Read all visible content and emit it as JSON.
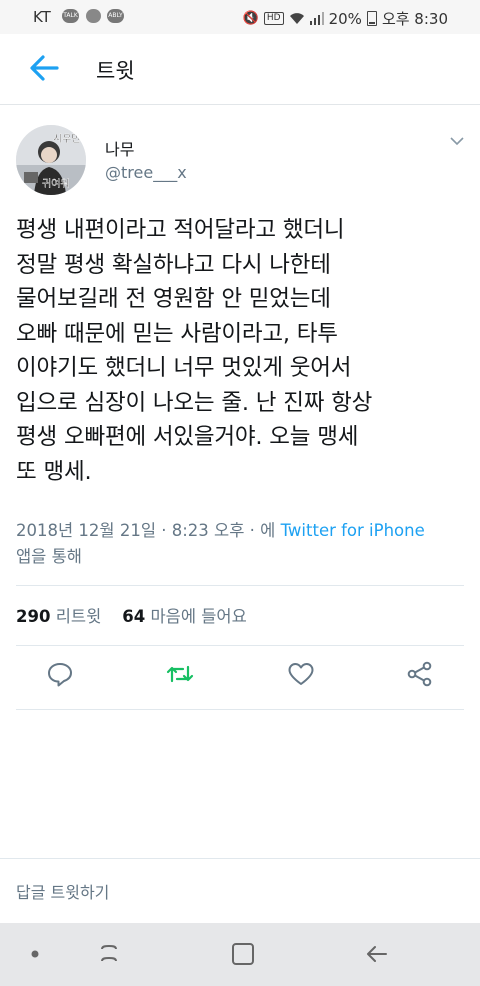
{
  "status_bar": {
    "carrier": "KT",
    "app_icons": [
      "TALK",
      "",
      "ABLY"
    ],
    "hd": "HD",
    "battery": "20%",
    "time": "오후 8:30"
  },
  "header": {
    "title": "트윗"
  },
  "tweet": {
    "avatar_text_top": "시우민",
    "avatar_text_bottom": "귀여워",
    "author_name": "나무",
    "author_handle": "@tree___x",
    "body_lines": [
      "평생 내편이라고 적어달라고 했더니",
      "정말 평생 확실하냐고 다시 나한테",
      "물어보길래 전 영원함 안 믿었는데",
      "오빠 때문에 믿는 사람이라고, 타투",
      "이야기도 했더니 너무 멋있게 웃어서",
      "입으로 심장이 나오는 줄. 난 진짜 항상",
      "평생 오빠편에 서있을거야. 오늘 맹세",
      "또 맹세."
    ],
    "timestamp": "2018년 12월 21일 · 8:23 오후 · 에",
    "source": "Twitter for iPhone",
    "source_suffix": "앱을 통해",
    "retweet_count": "290",
    "retweet_label": "리트윗",
    "like_count": "64",
    "like_label": "마음에 들어요"
  },
  "actions": {
    "icons": [
      "reply-icon",
      "retweet-icon",
      "like-icon",
      "share-icon"
    ],
    "retweet_color": "#17bf63",
    "default_color": "#657786"
  },
  "reply_bar": {
    "placeholder": "답글 트윗하기"
  },
  "colors": {
    "accent": "#1da1f2",
    "text": "#14171a",
    "secondary": "#657786"
  }
}
